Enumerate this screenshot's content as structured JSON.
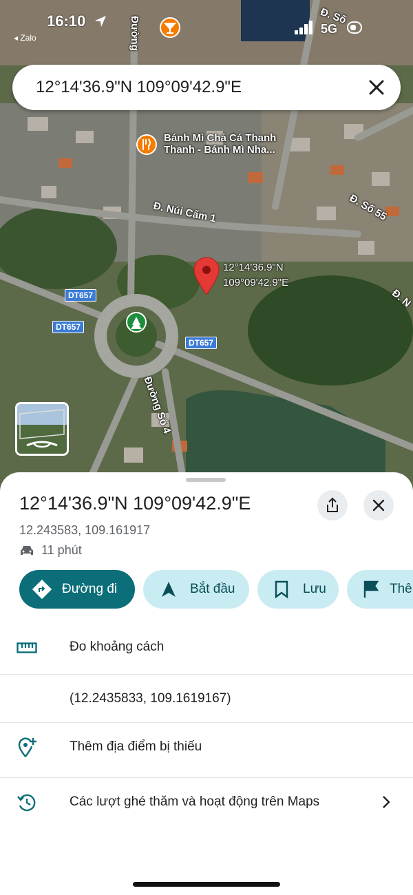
{
  "status_bar": {
    "time": "16:10",
    "back_app": "◂ Zalo",
    "network": "5G"
  },
  "search": {
    "value": "12°14'36.9\"N 109°09'42.9\"E"
  },
  "map": {
    "labels": {
      "restaurant": "Bánh Mì Chả Cá Thanh",
      "restaurant_line2": "Thanh - Bánh Mì Nha...",
      "street_nui_cam": "Đ. Núi Cấm 1",
      "street_so55": "Đ. Số 55",
      "street_so4": "Đường Số 4",
      "street_top": "Đ. Số",
      "street_duong": "Đường",
      "street_d_right": "Đ. N"
    },
    "road_badges": [
      "DT657",
      "DT657",
      "DT657"
    ],
    "pin_label_line1": "12°14'36.9\"N",
    "pin_label_line2": "109°09'42.9\"E"
  },
  "sheet": {
    "title": "12°14'36.9\"N 109°09'42.9\"E",
    "decimal_coords": "12.243583, 109.161917",
    "travel_time": "11 phút",
    "actions": {
      "directions": "Đường đi",
      "start": "Bắt đầu",
      "save": "Lưu",
      "more": "Thê"
    },
    "rows": {
      "measure": "Đo khoảng cách",
      "coords": "(12.2435833, 109.1619167)",
      "add_place": "Thêm địa điểm bị thiếu",
      "activity": "Các lượt ghé thăm và hoạt động trên Maps"
    }
  },
  "colors": {
    "primary": "#0b6e79",
    "chip_bg": "#c9ecf2",
    "pin": "#e53935"
  }
}
